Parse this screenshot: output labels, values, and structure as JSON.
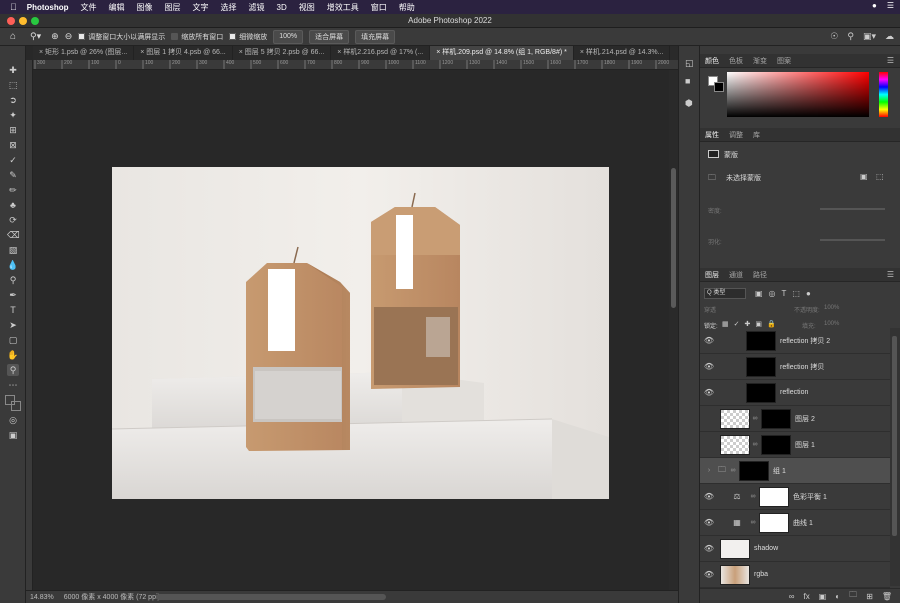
{
  "menubar": {
    "app": "Photoshop",
    "items": [
      "文件",
      "编辑",
      "图像",
      "图层",
      "文字",
      "选择",
      "滤镜",
      "3D",
      "视图",
      "增效工具",
      "窗口",
      "帮助"
    ]
  },
  "window": {
    "title": "Adobe Photoshop 2022"
  },
  "options": {
    "resize_windows": "调整窗口大小以满屏显示",
    "zoom_all": "缩放所有窗口",
    "scrubby_zoom": "细微缩放",
    "zoom_value": "100%",
    "fit_screen": "适合屏幕",
    "fill_screen": "填充屏幕"
  },
  "tabs": [
    {
      "label": "矩形 1.psb @ 26% (图层..."
    },
    {
      "label": "图层 1 拷贝 4.psb @ 66..."
    },
    {
      "label": "图层 5 拷贝 2.psb @ 66..."
    },
    {
      "label": "样机2.216.psd @ 17% (..."
    },
    {
      "label": "样机.209.psd @ 14.8% (组 1, RGB/8#) *",
      "active": true
    },
    {
      "label": "样机.214.psd @ 14.3%..."
    }
  ],
  "ruler_top_labels": [
    "300",
    "200",
    "100",
    "0",
    "100",
    "200",
    "300",
    "400",
    "500",
    "600",
    "700",
    "800",
    "900",
    "1000",
    "1100",
    "1200",
    "1300",
    "1400",
    "1500",
    "1600",
    "1700",
    "1800",
    "1900",
    "2000"
  ],
  "status": {
    "zoom": "14.83%",
    "doc_size": "6000 像素 x 4000 像素 (72 ppi)"
  },
  "color_panel": {
    "tabs": [
      "颜色",
      "色板",
      "渐变",
      "图案"
    ],
    "active": "颜色"
  },
  "properties_panel": {
    "tabs": [
      "属性",
      "调整",
      "库"
    ],
    "type": "蒙版",
    "no_mask": "未选择蒙版",
    "density_label": "密度:",
    "feather_label": "羽化:"
  },
  "layers_panel": {
    "tabs": [
      "图层",
      "通道",
      "路径"
    ],
    "filter_label": "Q 类型",
    "blend_mode": "穿透",
    "opacity_label": "不透明度:",
    "opacity_value": "100%",
    "lock_label": "锁定:",
    "fill_label": "填充:",
    "fill_value": "100%",
    "layers": [
      {
        "name": "reflection 拷贝 2",
        "visible": true
      },
      {
        "name": "reflection 拷贝",
        "visible": true
      },
      {
        "name": "reflection",
        "visible": true
      },
      {
        "name": "图层 2",
        "visible": false
      },
      {
        "name": "图层 1",
        "visible": false
      },
      {
        "name": "组 1",
        "visible": false,
        "selected": true
      },
      {
        "name": "色彩平衡 1",
        "visible": true
      },
      {
        "name": "曲线 1",
        "visible": true
      },
      {
        "name": "shadow",
        "visible": true
      },
      {
        "name": "rgba",
        "visible": true
      }
    ]
  },
  "colors": {
    "fg_swatch": "#ffffff",
    "bg_swatch": "#000000",
    "picker_hue": "#ff0000",
    "canvas_bg": "#282828",
    "panel_bg": "#3a3a3a",
    "selected_row": "#4f4f4f"
  }
}
